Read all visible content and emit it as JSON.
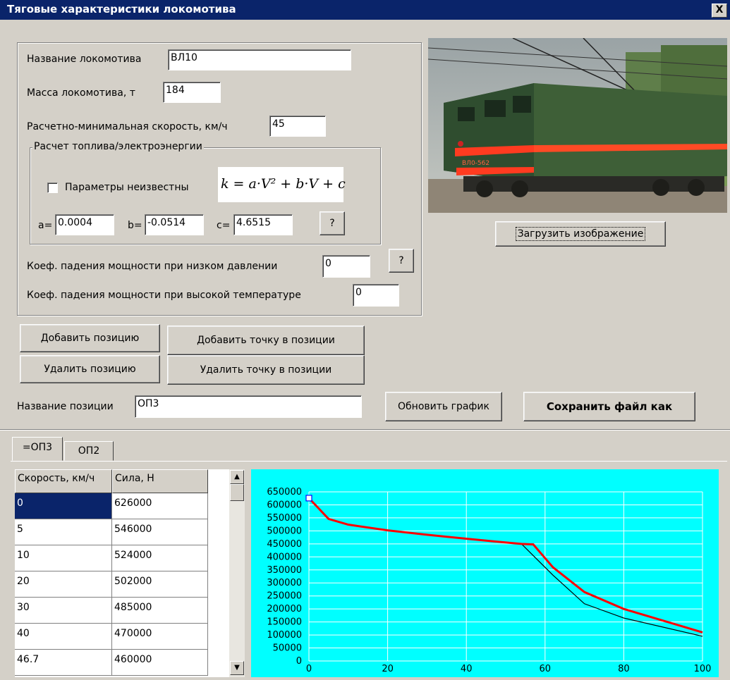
{
  "window": {
    "title": "Тяговые характеристики локомотива",
    "close_label": "X"
  },
  "form": {
    "name_label": "Название локомотива",
    "name_value": "ВЛ10",
    "mass_label": "Масса локомотива, т",
    "mass_value": "184",
    "speed_label": "Расчетно-минимальная скорость, км/ч",
    "speed_value": "45",
    "fuel_group_title": "Расчет топлива/электроэнергии",
    "unknown_params_label": "Параметры неизвестны",
    "unknown_params_checked": false,
    "formula": "k = a·V² + b·V + c",
    "a_label": "a=",
    "a_value": "0.0004",
    "b_label": "b=",
    "b_value": "-0.0514",
    "c_label": "c=",
    "c_value": "4.6515",
    "help_label": "?",
    "low_pressure_label": "Коеф. падения мощности при низком давлении",
    "low_pressure_value": "0",
    "high_temp_label": "Коеф. падения мощности при высокой температуре",
    "high_temp_value": "0",
    "help2_label": "?"
  },
  "image_panel": {
    "load_button": "Загрузить изображение",
    "loco_number": "ВЛ0-562"
  },
  "actions": {
    "add_position": "Добавить позицию",
    "delete_position": "Удалить позицию",
    "add_point": "Добавить точку в позиции",
    "delete_point": "Удалить точку в позиции",
    "position_name_label": "Название позиции",
    "position_name_value": "ОП3",
    "refresh_chart": "Обновить график",
    "save_as": "Сохранить файл как"
  },
  "tabs": [
    {
      "label": "=ОП3",
      "active": true
    },
    {
      "label": "ОП2",
      "active": false
    }
  ],
  "table": {
    "headers": [
      "Скорость, км/ч",
      "Сила, Н"
    ],
    "rows": [
      [
        "0",
        "626000"
      ],
      [
        "5",
        "546000"
      ],
      [
        "10",
        "524000"
      ],
      [
        "20",
        "502000"
      ],
      [
        "30",
        "485000"
      ],
      [
        "40",
        "470000"
      ],
      [
        "46.7",
        "460000"
      ]
    ],
    "selected_row": 0
  },
  "scroll_up": "▲",
  "scroll_down": "▼",
  "colors": {
    "chart_bg": "#00ffff",
    "series_red": "#ff0000",
    "series_black": "#000000",
    "selection": "#0a246a"
  },
  "chart_data": {
    "type": "line",
    "title": "",
    "xlabel": "",
    "ylabel": "",
    "xlim": [
      0,
      100
    ],
    "ylim": [
      0,
      650000
    ],
    "x_ticks": [
      0,
      20,
      40,
      60,
      80,
      100
    ],
    "y_ticks": [
      0,
      50000,
      100000,
      150000,
      200000,
      250000,
      300000,
      350000,
      400000,
      450000,
      500000,
      550000,
      600000,
      650000
    ],
    "grid": true,
    "series": [
      {
        "color": "#ff0000",
        "x": [
          0,
          5,
          10,
          20,
          30,
          40,
          46.7,
          54,
          57,
          62,
          70,
          80,
          100
        ],
        "y": [
          626000,
          546000,
          524000,
          502000,
          485000,
          470000,
          460000,
          450000,
          448000,
          360000,
          265000,
          200000,
          110000
        ]
      },
      {
        "color": "#000000",
        "x": [
          0,
          5,
          10,
          20,
          30,
          40,
          46.7,
          54,
          62,
          70,
          80,
          100
        ],
        "y": [
          626000,
          546000,
          524000,
          502000,
          485000,
          470000,
          460000,
          450000,
          330000,
          220000,
          165000,
          95000
        ]
      }
    ]
  }
}
